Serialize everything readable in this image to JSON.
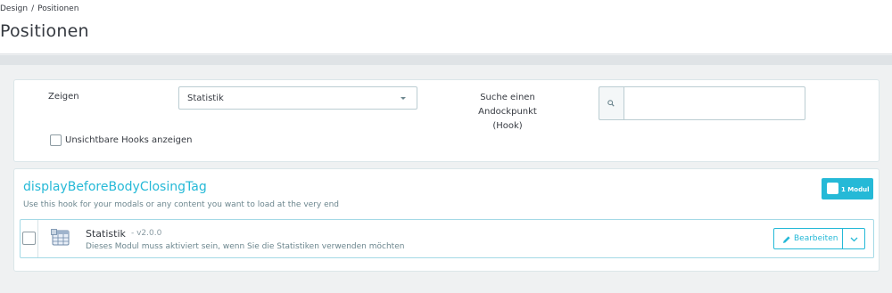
{
  "breadcrumb": {
    "parent": "Design",
    "separator": "/",
    "current": "Positionen"
  },
  "page_title": "Positionen",
  "filter": {
    "show_label": "Zeigen",
    "show_selected": "Statistik",
    "search_label_line1": "Suche einen Andockpunkt",
    "search_label_line2": "(Hook)",
    "search_value": "",
    "hidden_hooks_label": "Unsichtbare Hooks anzeigen",
    "hidden_hooks_checked": false
  },
  "hook": {
    "name": "displayBeforeBodyClosingTag",
    "description": "Use this hook for your modals or any content you want to load at the very end",
    "module_count_label": "1 Modul",
    "modules": [
      {
        "name": "Statistik",
        "version": "- v2.0.0",
        "description": "Dieses Modul muss aktiviert sein, wenn Sie die Statistiken verwenden möchten",
        "edit_label": "Bearbeiten",
        "icon": "table-icon"
      }
    ]
  },
  "colors": {
    "accent": "#25b9d7",
    "text": "#363a41",
    "muted": "#6c868e",
    "background": "#eff1f2"
  }
}
